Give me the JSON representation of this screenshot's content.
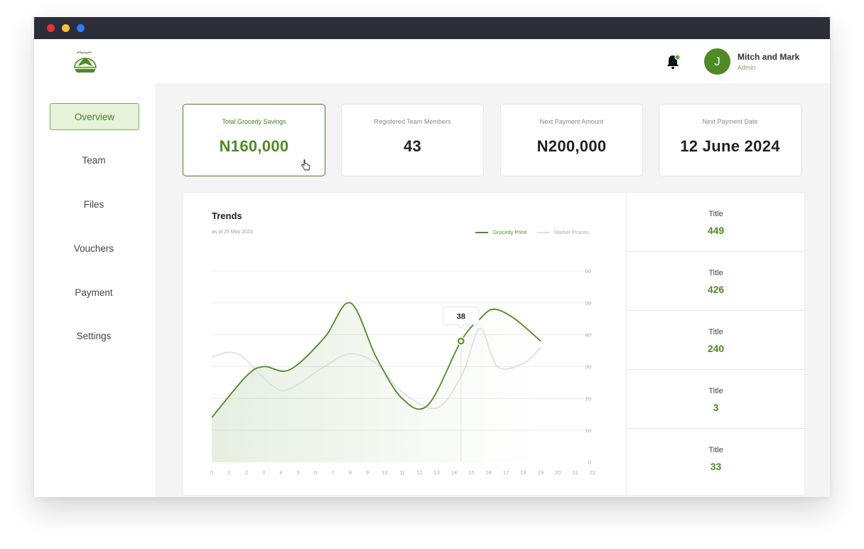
{
  "header": {
    "user": {
      "initial": "J",
      "name": "Mitch and Mark",
      "role": "Admin"
    },
    "logo": "grocedy-logo",
    "icons": [
      "bell-icon"
    ]
  },
  "sidebar": {
    "items": [
      {
        "label": "Overview",
        "active": true
      },
      {
        "label": "Team"
      },
      {
        "label": "Files"
      },
      {
        "label": "Vouchers"
      },
      {
        "label": "Payment"
      },
      {
        "label": "Settings"
      }
    ]
  },
  "summary_cards": [
    {
      "label": "Total Grocedy Savings",
      "value": "N160,000",
      "selected": true
    },
    {
      "label": "Registered Team Members",
      "value": "43"
    },
    {
      "label": "Next Payment Amount",
      "value": "N200,000"
    },
    {
      "label": "Next Payment Date",
      "value": "12 June 2024"
    }
  ],
  "trends": {
    "title": "Trends",
    "subtitle": "as of 25 May 2023.",
    "legend": [
      "Grocedy Price",
      "Market Proces"
    ]
  },
  "stats": [
    {
      "title": "Title",
      "value": "449"
    },
    {
      "title": "Title",
      "value": "426"
    },
    {
      "title": "Title",
      "value": "240"
    },
    {
      "title": "Title",
      "value": "3"
    },
    {
      "title": "Title",
      "value": "33"
    }
  ],
  "colors": {
    "accent": "#4e8a25",
    "accent_light": "#e6f2d9",
    "secondary_line": "#d9dde3",
    "titlebar": "#2b2d38"
  },
  "chart_data": {
    "type": "line",
    "x": [
      0,
      1,
      2,
      3,
      4,
      5,
      6,
      7,
      8,
      9,
      10,
      11,
      12,
      13,
      14,
      15,
      16,
      17,
      18,
      19,
      20,
      21,
      22
    ],
    "ylim": [
      0,
      60
    ],
    "yticks": [
      0,
      10,
      20,
      30,
      40,
      50,
      60
    ],
    "xlim": [
      0,
      22
    ],
    "grid": true,
    "legend_position": "top-right",
    "series": [
      {
        "name": "Grocedy Price",
        "x": [
          0,
          2,
          3,
          4.5,
          6.5,
          8,
          9.5,
          11,
          12.5,
          14.4,
          15.5,
          16.3,
          17.5,
          19
        ],
        "values": [
          14,
          27,
          30,
          29,
          39,
          50,
          33,
          20,
          18,
          38,
          45,
          48,
          45,
          38
        ]
      },
      {
        "name": "Market Proces",
        "x": [
          0,
          1.5,
          3.5,
          4.5,
          6.5,
          8,
          9.5,
          11,
          13,
          14.5,
          15.5,
          16.5,
          18,
          19
        ],
        "values": [
          33,
          34,
          24,
          23,
          30,
          34,
          31,
          22,
          17,
          28,
          42,
          30,
          31,
          36
        ]
      }
    ],
    "annotation": {
      "x": 14.4,
      "label": "38"
    }
  }
}
